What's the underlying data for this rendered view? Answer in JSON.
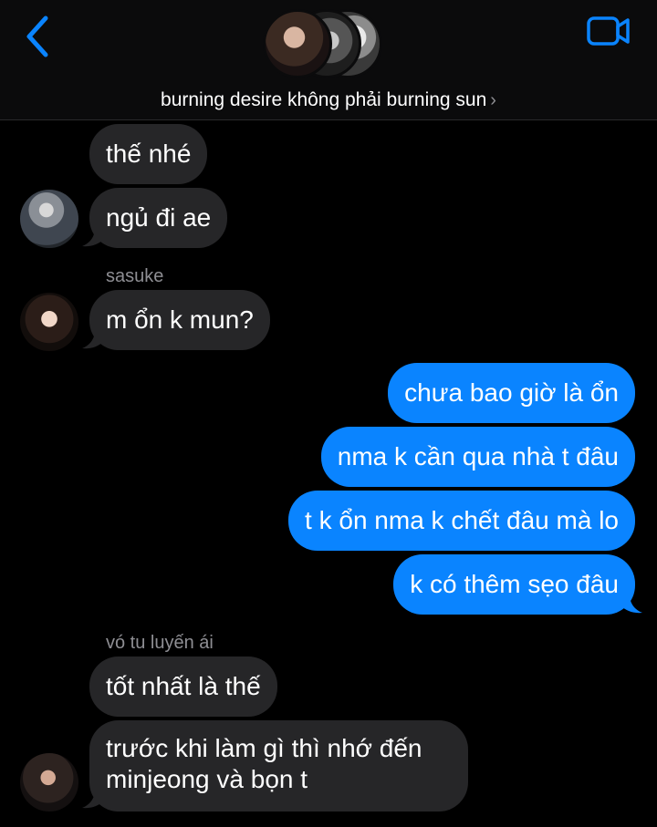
{
  "header": {
    "group_name": "burning desire không phải burning sun",
    "back_icon": "chevron-left-icon",
    "video_icon": "video-camera-icon",
    "accent_color": "#0a84ff"
  },
  "messages": [
    {
      "direction": "in",
      "text": "thế nhé"
    },
    {
      "direction": "in",
      "text": "ngủ đi ae"
    },
    {
      "direction": "in",
      "sender": "sasuke",
      "text": "m ổn k mun?"
    },
    {
      "direction": "out",
      "text": "chưa bao giờ là ổn"
    },
    {
      "direction": "out",
      "text": "nma k cần qua nhà t đâu"
    },
    {
      "direction": "out",
      "text": "t k ổn nma k chết đâu mà lo"
    },
    {
      "direction": "out",
      "text": "k có thêm sẹo đâu"
    },
    {
      "direction": "in",
      "sender": "vó tu luyến ái",
      "text": "tốt nhất là thế"
    },
    {
      "direction": "in",
      "text": "trước khi làm gì thì nhớ đến minjeong và bọn t"
    }
  ],
  "colors": {
    "incoming_bubble": "#262628",
    "outgoing_bubble": "#0a84ff",
    "background": "#000000",
    "sender_label": "#8e8e93"
  }
}
